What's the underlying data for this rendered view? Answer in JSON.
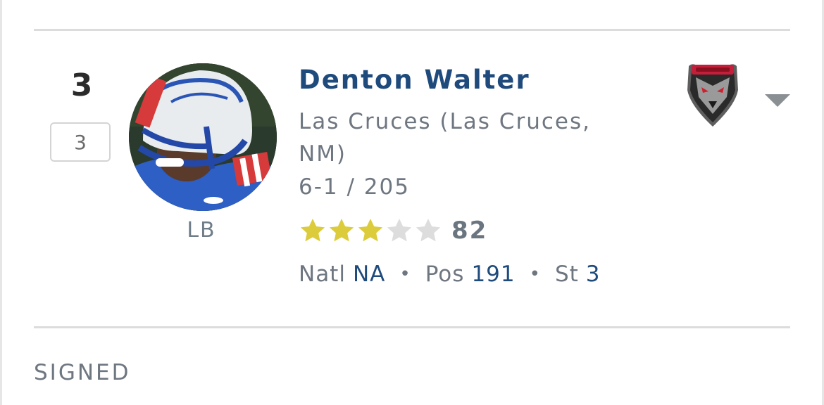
{
  "player": {
    "rank": "3",
    "rank_box": "3",
    "position": "LB",
    "name": "Denton Walter",
    "school": "Las Cruces (Las Cruces, NM)",
    "measurements": "6-1 / 205",
    "rating": "82",
    "stars_filled": 3,
    "stars_total": 5,
    "rankings": {
      "natl_label": "Natl",
      "natl_value": "NA",
      "pos_label": "Pos",
      "pos_value": "191",
      "st_label": "St",
      "st_value": "3"
    },
    "separator": "•",
    "committed_team_logo": "lobos-logo"
  },
  "section": {
    "status": "SIGNED"
  },
  "colors": {
    "name": "#1e4a7c",
    "star_filled": "#dccb3a",
    "star_empty": "#dddddd",
    "muted_text": "#6e7680"
  },
  "icons": {
    "expand": "chevron-down-icon"
  }
}
